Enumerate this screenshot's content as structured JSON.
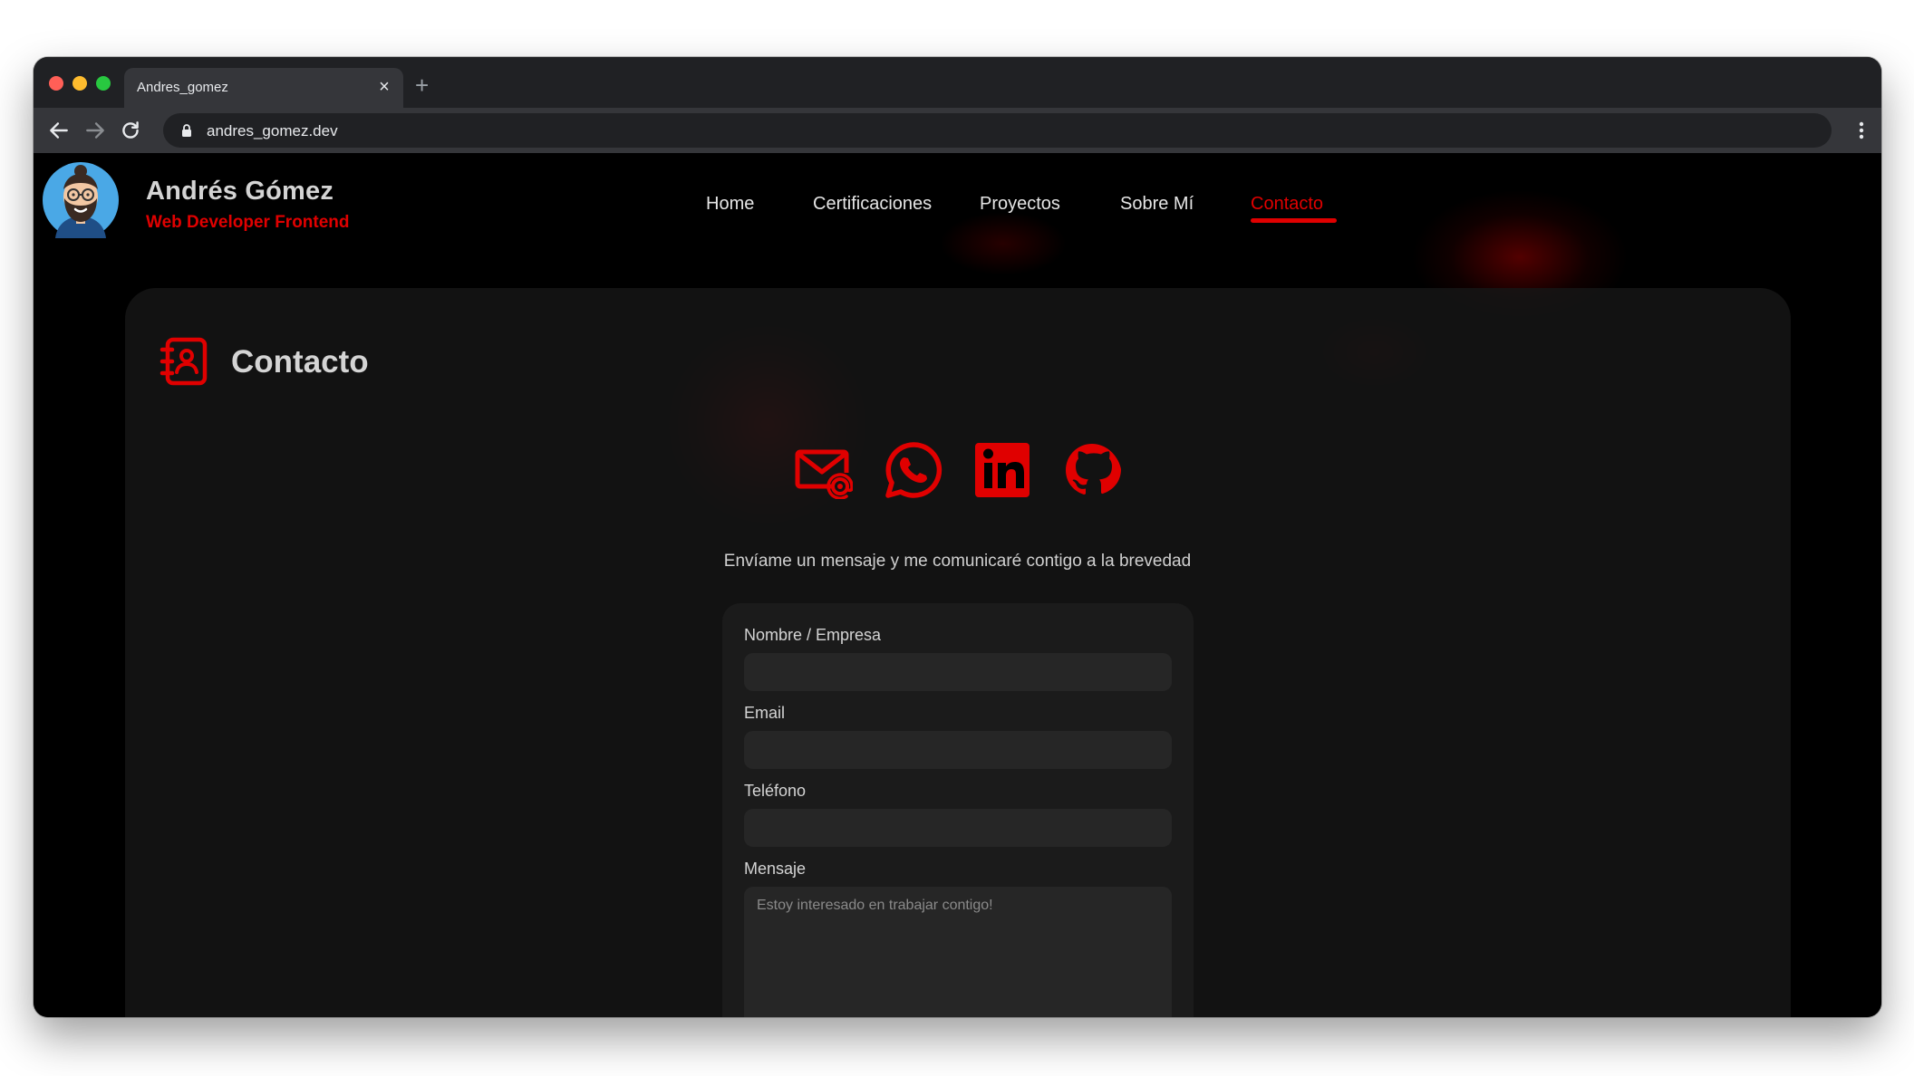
{
  "browser": {
    "tab_title": "Andres_gomez",
    "tab_close": "×",
    "new_tab": "+",
    "url": "andres_gomez.dev"
  },
  "header": {
    "name": "Andrés Gómez",
    "role": "Web Developer Frontend",
    "nav": [
      {
        "label": "Home"
      },
      {
        "label": "Certificaciones"
      },
      {
        "label": "Proyectos"
      },
      {
        "label": "Sobre Mí"
      },
      {
        "label": "Contacto",
        "active": true
      }
    ]
  },
  "contact": {
    "title": "Contacto",
    "social_icons": [
      "email-icon",
      "whatsapp-icon",
      "linkedin-icon",
      "github-icon"
    ],
    "tagline": "Envíame un mensaje y me comunicaré contigo a la brevedad",
    "form": {
      "name_label": "Nombre / Empresa",
      "name_value": "",
      "email_label": "Email",
      "email_value": "",
      "phone_label": "Teléfono",
      "phone_value": "",
      "message_label": "Mensaje",
      "message_placeholder": "Estoy interesado en trabajar contigo!"
    }
  },
  "colors": {
    "accent": "#e00000",
    "background": "#000000",
    "card": "#161616",
    "input": "#262626"
  }
}
